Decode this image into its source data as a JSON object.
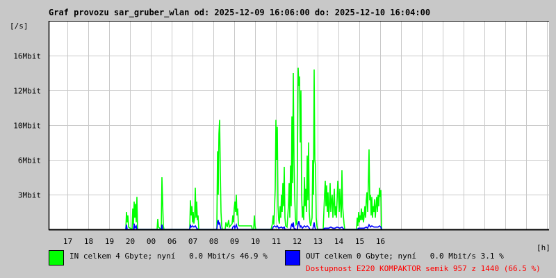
{
  "title": "Graf provozu sar_gruber_wlan od: 2025-12-09 16:06:00 do: 2025-12-10 16:04:00",
  "chart_data": {
    "type": "line",
    "title": "Graf provozu sar_gruber_wlan od: 2025-12-09 16:06:00 do: 2025-12-10 16:04:00",
    "ylabel": "[/s]",
    "xlabel": "[h]",
    "x_unit": "minutes since 2025-12-09 16:06",
    "x_range": [
      0,
      1440
    ],
    "y_ticks": [
      {
        "label": "16Mbit",
        "value": 16
      },
      {
        "label": "12Mbit",
        "value": 12
      },
      {
        "label": "10Mbit",
        "value": 10
      },
      {
        "label": "6Mbit",
        "value": 6
      },
      {
        "label": "3Mbit",
        "value": 3
      }
    ],
    "x_tick_labels": [
      "17",
      "18",
      "19",
      "20",
      "00",
      "06",
      "07",
      "08",
      "09",
      "10",
      "11",
      "12",
      "13",
      "14",
      "15",
      "16"
    ],
    "grid": true,
    "series": [
      {
        "name": "IN",
        "color": "#00ff00",
        "points": [
          [
            222,
            0
          ],
          [
            224,
            1.5
          ],
          [
            226,
            0.6
          ],
          [
            228,
            1.2
          ],
          [
            230,
            0.2
          ],
          [
            240,
            0
          ],
          [
            242,
            1.8
          ],
          [
            244,
            0.4
          ],
          [
            246,
            2.4
          ],
          [
            248,
            1.0
          ],
          [
            250,
            2.2
          ],
          [
            252,
            0.6
          ],
          [
            254,
            2.8
          ],
          [
            256,
            0
          ],
          [
            312,
            0
          ],
          [
            314,
            0.9
          ],
          [
            316,
            0.2
          ],
          [
            324,
            0
          ],
          [
            326,
            4.5
          ],
          [
            328,
            2.4
          ],
          [
            330,
            0.3
          ],
          [
            332,
            0
          ],
          [
            406,
            0
          ],
          [
            408,
            2.5
          ],
          [
            410,
            1.2
          ],
          [
            412,
            2.0
          ],
          [
            414,
            0.6
          ],
          [
            416,
            1.5
          ],
          [
            418,
            0.5
          ],
          [
            420,
            1.0
          ],
          [
            422,
            3.6
          ],
          [
            424,
            1.0
          ],
          [
            426,
            2.4
          ],
          [
            428,
            0.8
          ],
          [
            430,
            1.2
          ],
          [
            432,
            0
          ],
          [
            484,
            0
          ],
          [
            486,
            7.0
          ],
          [
            488,
            3.0
          ],
          [
            490,
            9.0
          ],
          [
            492,
            10.3
          ],
          [
            494,
            5.0
          ],
          [
            496,
            1.5
          ],
          [
            498,
            0.3
          ],
          [
            500,
            0
          ],
          [
            508,
            0
          ],
          [
            510,
            0.6
          ],
          [
            514,
            0.2
          ],
          [
            518,
            0.8
          ],
          [
            520,
            0.2
          ],
          [
            528,
            0.5
          ],
          [
            530,
            1.2
          ],
          [
            532,
            0.6
          ],
          [
            534,
            1.8
          ],
          [
            536,
            2.4
          ],
          [
            538,
            1.5
          ],
          [
            540,
            3.0
          ],
          [
            542,
            1.2
          ],
          [
            544,
            1.8
          ],
          [
            546,
            0.4
          ],
          [
            548,
            0.3
          ],
          [
            560,
            0.3
          ],
          [
            580,
            0.3
          ],
          [
            584,
            0.3
          ],
          [
            586,
            0
          ],
          [
            590,
            0
          ],
          [
            592,
            1.2
          ],
          [
            594,
            0.3
          ],
          [
            596,
            0
          ],
          [
            640,
            0
          ],
          [
            644,
            0.5
          ],
          [
            646,
            1.2
          ],
          [
            648,
            0.4
          ],
          [
            650,
            1.8
          ],
          [
            652,
            3.5
          ],
          [
            654,
            10.3
          ],
          [
            656,
            6.0
          ],
          [
            658,
            9.8
          ],
          [
            660,
            2.0
          ],
          [
            662,
            0.8
          ],
          [
            664,
            0.5
          ],
          [
            666,
            2.0
          ],
          [
            668,
            1.0
          ],
          [
            670,
            3.0
          ],
          [
            672,
            1.5
          ],
          [
            674,
            4.0
          ],
          [
            676,
            2.0
          ],
          [
            678,
            5.4
          ],
          [
            680,
            1.0
          ],
          [
            682,
            0.3
          ],
          [
            686,
            0.2
          ],
          [
            690,
            2.0
          ],
          [
            692,
            4.0
          ],
          [
            694,
            1.0
          ],
          [
            696,
            5.5
          ],
          [
            698,
            2.0
          ],
          [
            700,
            10.5
          ],
          [
            702,
            4.0
          ],
          [
            704,
            14.0
          ],
          [
            706,
            6.0
          ],
          [
            708,
            3.0
          ],
          [
            710,
            1.0
          ],
          [
            712,
            0.4
          ],
          [
            714,
            0.5
          ],
          [
            716,
            6.0
          ],
          [
            718,
            14.6
          ],
          [
            720,
            12.5
          ],
          [
            722,
            13.6
          ],
          [
            724,
            8.0
          ],
          [
            726,
            12.0
          ],
          [
            728,
            3.0
          ],
          [
            730,
            1.0
          ],
          [
            732,
            2.0
          ],
          [
            734,
            0.8
          ],
          [
            736,
            4.5
          ],
          [
            738,
            2.0
          ],
          [
            740,
            3.5
          ],
          [
            742,
            1.5
          ],
          [
            744,
            6.5
          ],
          [
            746,
            2.5
          ],
          [
            748,
            8.0
          ],
          [
            750,
            1.5
          ],
          [
            752,
            0.6
          ],
          [
            754,
            0.3
          ],
          [
            758,
            1.0
          ],
          [
            760,
            6.0
          ],
          [
            762,
            3.0
          ],
          [
            764,
            14.4
          ],
          [
            766,
            6.0
          ],
          [
            768,
            5.5
          ],
          [
            770,
            1.0
          ],
          [
            772,
            0.3
          ],
          [
            774,
            0
          ],
          [
            790,
            0
          ],
          [
            792,
            1.5
          ],
          [
            794,
            3.0
          ],
          [
            796,
            4.2
          ],
          [
            798,
            2.0
          ],
          [
            800,
            3.8
          ],
          [
            802,
            1.5
          ],
          [
            804,
            3.2
          ],
          [
            806,
            1.0
          ],
          [
            808,
            2.0
          ],
          [
            810,
            4.0
          ],
          [
            812,
            1.5
          ],
          [
            814,
            2.5
          ],
          [
            816,
            3.0
          ],
          [
            818,
            1.0
          ],
          [
            820,
            2.2
          ],
          [
            822,
            3.5
          ],
          [
            824,
            1.2
          ],
          [
            826,
            2.0
          ],
          [
            828,
            1.0
          ],
          [
            830,
            2.5
          ],
          [
            832,
            4.2
          ],
          [
            834,
            3.0
          ],
          [
            836,
            1.5
          ],
          [
            838,
            3.5
          ],
          [
            840,
            2.2
          ],
          [
            842,
            1.0
          ],
          [
            844,
            5.1
          ],
          [
            846,
            2.0
          ],
          [
            848,
            1.2
          ],
          [
            850,
            0.5
          ],
          [
            852,
            0
          ],
          [
            886,
            0
          ],
          [
            888,
            1.0
          ],
          [
            890,
            0.3
          ],
          [
            892,
            1.5
          ],
          [
            894,
            0.6
          ],
          [
            896,
            1.2
          ],
          [
            898,
            0.8
          ],
          [
            900,
            1.8
          ],
          [
            902,
            0.8
          ],
          [
            904,
            1.5
          ],
          [
            906,
            0.6
          ],
          [
            908,
            1.2
          ],
          [
            910,
            2.0
          ],
          [
            912,
            1.0
          ],
          [
            914,
            2.5
          ],
          [
            916,
            3.2
          ],
          [
            918,
            1.5
          ],
          [
            920,
            4.0
          ],
          [
            922,
            7.2
          ],
          [
            924,
            2.5
          ],
          [
            926,
            3.0
          ],
          [
            928,
            1.2
          ],
          [
            930,
            2.8
          ],
          [
            932,
            1.0
          ],
          [
            934,
            2.0
          ],
          [
            936,
            1.5
          ],
          [
            938,
            2.6
          ],
          [
            940,
            1.0
          ],
          [
            942,
            2.0
          ],
          [
            944,
            2.8
          ],
          [
            946,
            1.5
          ],
          [
            948,
            3.0
          ],
          [
            950,
            2.0
          ],
          [
            952,
            3.6
          ],
          [
            954,
            2.8
          ],
          [
            956,
            3.4
          ],
          [
            958,
            0
          ]
        ]
      },
      {
        "name": "OUT",
        "color": "#0000ff",
        "points": [
          [
            222,
            0
          ],
          [
            224,
            0.4
          ],
          [
            226,
            0
          ],
          [
            244,
            0
          ],
          [
            246,
            0.5
          ],
          [
            248,
            0.1
          ],
          [
            252,
            0.3
          ],
          [
            254,
            0
          ],
          [
            324,
            0
          ],
          [
            326,
            0.4
          ],
          [
            328,
            0
          ],
          [
            406,
            0
          ],
          [
            408,
            0.4
          ],
          [
            410,
            0.2
          ],
          [
            414,
            0.3
          ],
          [
            418,
            0.2
          ],
          [
            422,
            0.3
          ],
          [
            426,
            0.1
          ],
          [
            430,
            0
          ],
          [
            484,
            0
          ],
          [
            486,
            0.6
          ],
          [
            488,
            0.8
          ],
          [
            490,
            0.4
          ],
          [
            492,
            0.6
          ],
          [
            494,
            0.2
          ],
          [
            496,
            0
          ],
          [
            528,
            0
          ],
          [
            530,
            0.2
          ],
          [
            534,
            0.3
          ],
          [
            536,
            0.1
          ],
          [
            540,
            0.4
          ],
          [
            542,
            0.2
          ],
          [
            544,
            0
          ],
          [
            644,
            0
          ],
          [
            646,
            0.2
          ],
          [
            650,
            0.3
          ],
          [
            654,
            0.2
          ],
          [
            658,
            0.3
          ],
          [
            662,
            0.1
          ],
          [
            670,
            0.2
          ],
          [
            674,
            0.1
          ],
          [
            678,
            0.2
          ],
          [
            680,
            0
          ],
          [
            696,
            0
          ],
          [
            698,
            0.3
          ],
          [
            700,
            0.5
          ],
          [
            702,
            0.2
          ],
          [
            704,
            0.6
          ],
          [
            706,
            0.1
          ],
          [
            712,
            0
          ],
          [
            716,
            0
          ],
          [
            718,
            0.5
          ],
          [
            720,
            0.7
          ],
          [
            722,
            0.4
          ],
          [
            724,
            0.2
          ],
          [
            726,
            0.3
          ],
          [
            730,
            0.1
          ],
          [
            736,
            0.3
          ],
          [
            740,
            0.2
          ],
          [
            744,
            0.3
          ],
          [
            748,
            0.2
          ],
          [
            752,
            0
          ],
          [
            760,
            0
          ],
          [
            762,
            0.3
          ],
          [
            764,
            0.6
          ],
          [
            766,
            0.2
          ],
          [
            768,
            0
          ],
          [
            790,
            0
          ],
          [
            794,
            0.1
          ],
          [
            800,
            0.1
          ],
          [
            806,
            0.1
          ],
          [
            812,
            0.2
          ],
          [
            818,
            0.1
          ],
          [
            824,
            0.1
          ],
          [
            830,
            0.2
          ],
          [
            838,
            0.1
          ],
          [
            844,
            0.2
          ],
          [
            850,
            0
          ],
          [
            888,
            0
          ],
          [
            892,
            0.1
          ],
          [
            900,
            0.1
          ],
          [
            908,
            0.1
          ],
          [
            914,
            0.2
          ],
          [
            918,
            0.1
          ],
          [
            922,
            0.4
          ],
          [
            926,
            0.2
          ],
          [
            930,
            0.3
          ],
          [
            936,
            0.2
          ],
          [
            942,
            0.2
          ],
          [
            948,
            0.2
          ],
          [
            952,
            0.3
          ],
          [
            956,
            0.2
          ],
          [
            958,
            0
          ]
        ]
      }
    ]
  },
  "legend": {
    "in_text": "IN celkem 4 Gbyte; nyní   0.0 Mbit/s 46.9 %",
    "out_text": "OUT celkem 0 Gbyte; nyní   0.0 Mbit/s 3.1 %",
    "availability": "Dostupnost E220 KOMPAKTOR semik 957 z 1440 (66.5 %)",
    "in_color": "#00ff00",
    "out_color": "#0000ff",
    "availability_color": "#ff0000"
  }
}
